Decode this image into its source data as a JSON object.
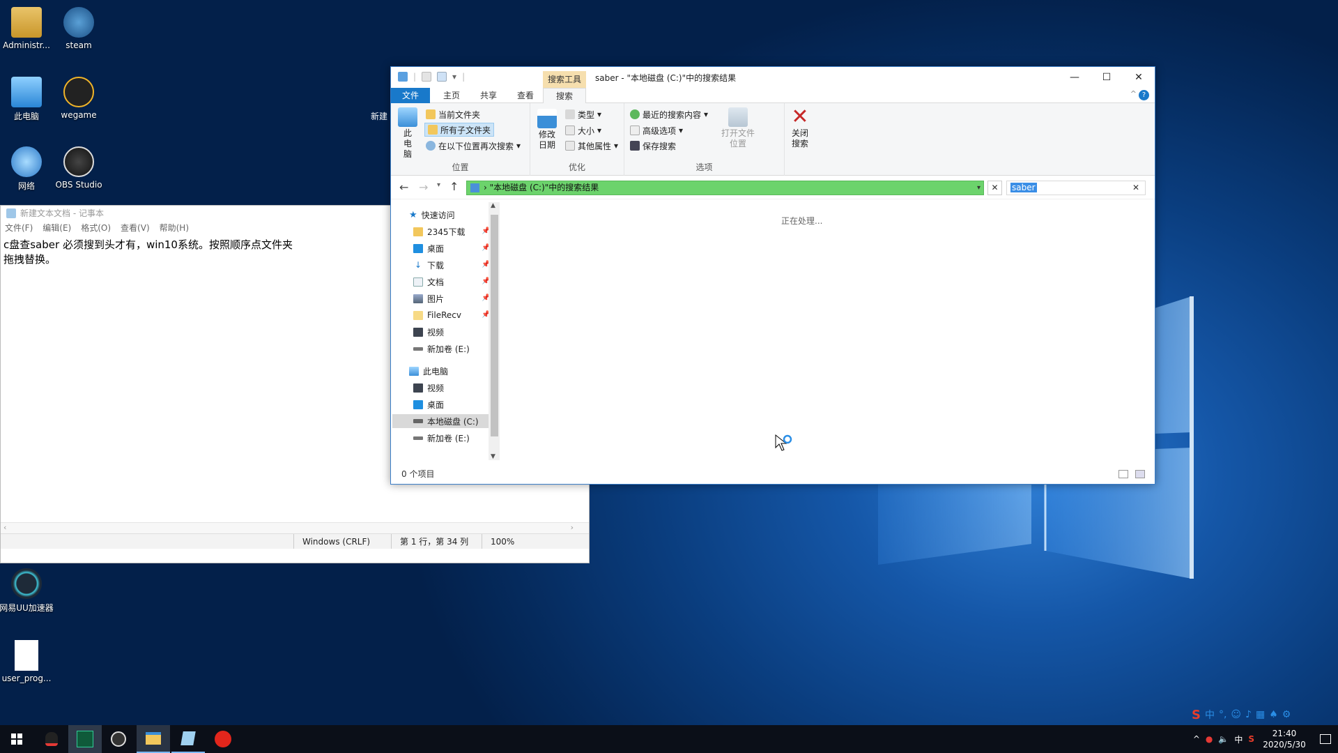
{
  "desktop": {
    "icons": [
      {
        "label": "Administr..."
      },
      {
        "label": "steam"
      },
      {
        "label": "此电脑"
      },
      {
        "label": "wegame"
      },
      {
        "label": "网络"
      },
      {
        "label": "OBS Studio"
      },
      {
        "label": "网易UU加速器"
      },
      {
        "label": "user_prog..."
      }
    ],
    "partial_label": "新建"
  },
  "notepad": {
    "title": "新建文本文档 - 记事本",
    "menu": [
      "文件(F)",
      "编辑(E)",
      "格式(O)",
      "查看(V)",
      "帮助(H)"
    ],
    "text": "c盘查saber 必须搜到头才有，win10系统。按照顺序点文件夹\n拖拽替换。",
    "status": {
      "encoding": "Windows (CRLF)",
      "position": "第 1 行，第 34 列",
      "zoom": "100%"
    }
  },
  "explorer": {
    "context_tab": "搜索工具",
    "title": "saber - \"本地磁盘 (C:)\"中的搜索结果",
    "tabs": [
      "文件",
      "主页",
      "共享",
      "查看",
      "搜索"
    ],
    "ribbon": {
      "this_pc_label": "此电脑",
      "location": {
        "current_folder": "当前文件夹",
        "all_subfolders": "所有子文件夹",
        "search_again": "在以下位置再次搜索",
        "label": "位置"
      },
      "refine": {
        "modified_date": "修改日期",
        "type": "类型",
        "size": "大小",
        "other_props": "其他属性",
        "label": "优化"
      },
      "options": {
        "recent": "最近的搜索内容",
        "advanced": "高级选项",
        "save_search": "保存搜索",
        "open_location": "打开文件位置",
        "label": "选项"
      },
      "close_search": "关闭搜索"
    },
    "address": "\"本地磁盘 (C:)\"中的搜索结果",
    "search_value": "saber",
    "nav": [
      {
        "label": "快速访问",
        "pinned": false
      },
      {
        "label": "2345下载",
        "pinned": true
      },
      {
        "label": "桌面",
        "pinned": true
      },
      {
        "label": "下载",
        "pinned": true
      },
      {
        "label": "文档",
        "pinned": true
      },
      {
        "label": "图片",
        "pinned": true
      },
      {
        "label": "FileRecv",
        "pinned": true
      },
      {
        "label": "视频",
        "pinned": false
      },
      {
        "label": "新加卷 (E:)",
        "pinned": false
      },
      {
        "label": "此电脑",
        "pinned": false
      },
      {
        "label": "视频",
        "pinned": false
      },
      {
        "label": "桌面",
        "pinned": false
      },
      {
        "label": "本地磁盘 (C:)",
        "pinned": false
      },
      {
        "label": "新加卷 (E:)",
        "pinned": false
      }
    ],
    "processing": "正在处理...",
    "item_count": "0 个项目"
  },
  "taskbar": {
    "time": "21:40",
    "date": "2020/5/30",
    "ime_lang": "中"
  },
  "colors": {
    "accent": "#1979ca",
    "address_bg": "#6cd36c",
    "context_tab": "#f6dfae"
  }
}
